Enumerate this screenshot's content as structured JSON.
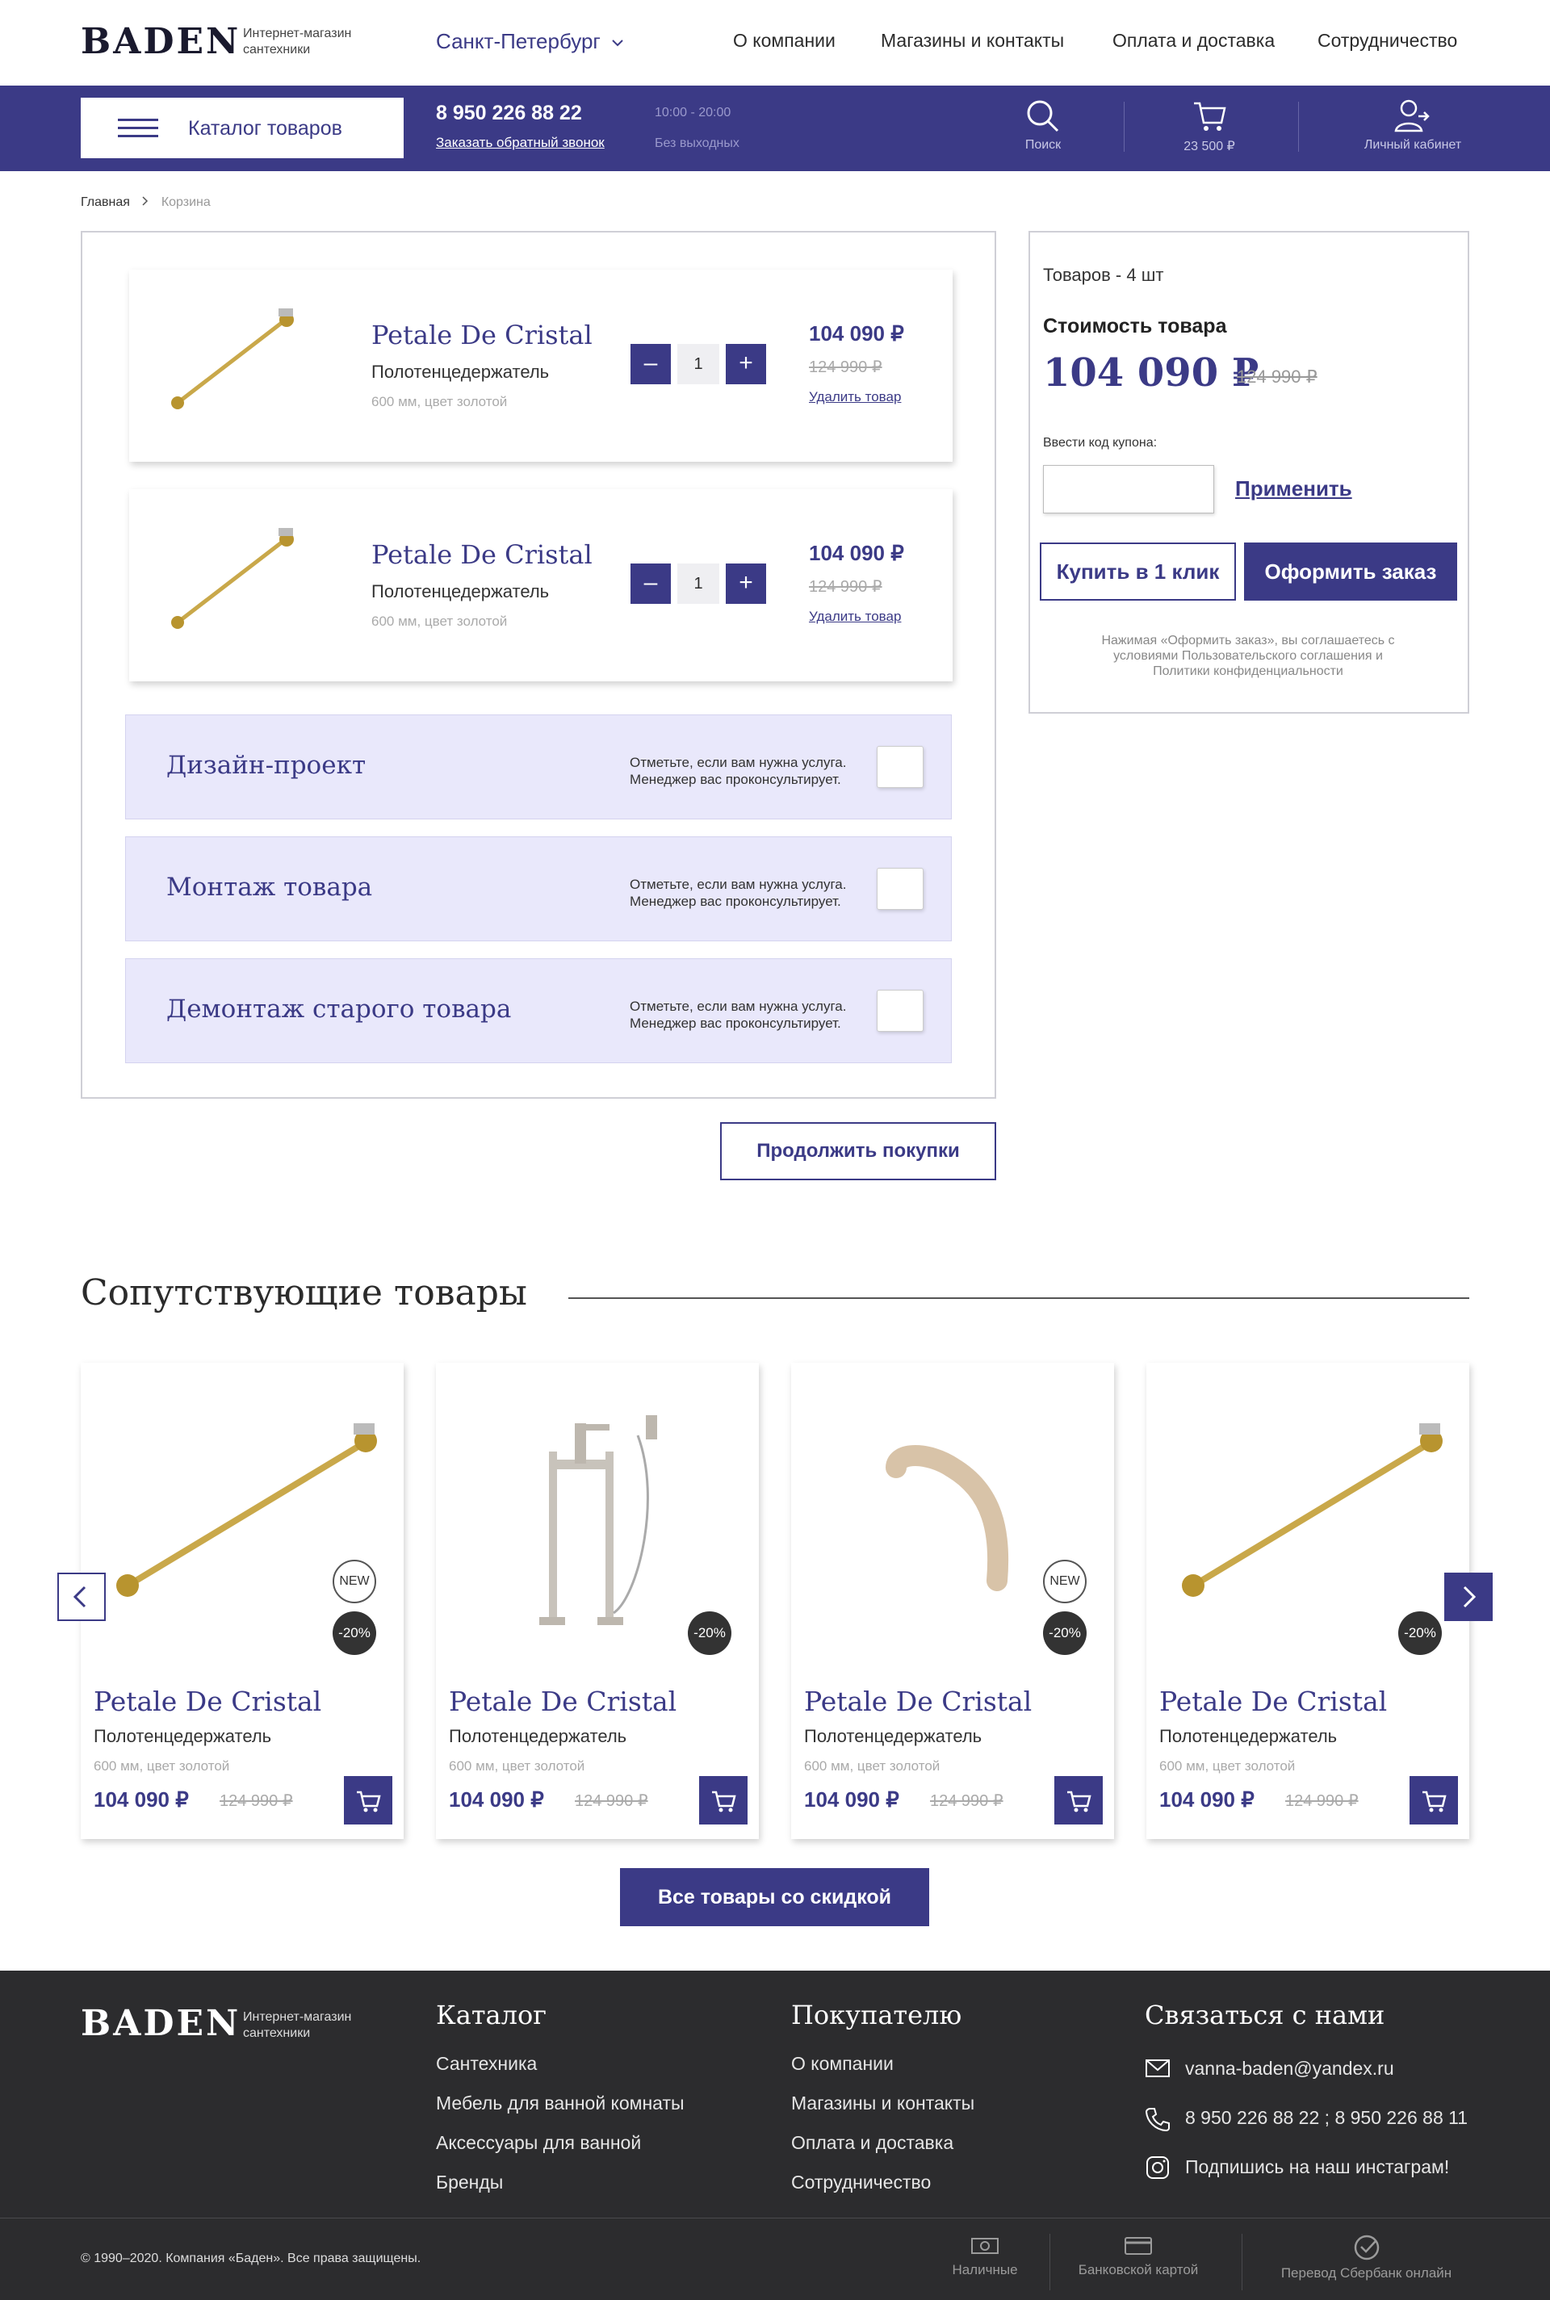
{
  "header": {
    "logo": "BADEN",
    "logo_sub_1": "Интернет-магазин",
    "logo_sub_2": "сантехники",
    "city": "Санкт-Петербург",
    "nav": [
      "О компании",
      "Магазины и контакты",
      "Оплата и доставка",
      "Сотрудничество"
    ],
    "catalog_label": "Каталог товаров",
    "phone": "8 950 226 88 22",
    "callback": "Заказать обратный звонок",
    "hours": "10:00 - 20:00",
    "days": "Без выходных",
    "search_label": "Поиск",
    "cart_total": "23 500 ₽",
    "account_label": "Личный кабинет"
  },
  "breadcrumb": {
    "home": "Главная",
    "current": "Корзина"
  },
  "cart": {
    "items": [
      {
        "title": "Petale De Cristal",
        "subtitle": "Полотенцедержатель",
        "meta": "600 мм, цвет золотой",
        "qty": "1",
        "price": "104 090 ₽",
        "old_price": "124 990 ₽",
        "remove": "Удалить товар"
      },
      {
        "title": "Petale De Cristal",
        "subtitle": "Полотенцедержатель",
        "meta": "600 мм, цвет золотой",
        "qty": "1",
        "price": "104 090 ₽",
        "old_price": "124 990 ₽",
        "remove": "Удалить товар"
      }
    ],
    "services": [
      {
        "title": "Дизайн-проект",
        "note_1": "Отметьте, если вам нужна услуга.",
        "note_2": "Менеджер вас проконсультирует."
      },
      {
        "title": "Монтаж товара",
        "note_1": "Отметьте, если вам нужна услуга.",
        "note_2": "Менеджер вас проконсультирует."
      },
      {
        "title": "Демонтаж старого товара",
        "note_1": "Отметьте, если вам нужна услуга.",
        "note_2": "Менеджер вас проконсультирует."
      }
    ],
    "continue": "Продолжить покупки"
  },
  "summary": {
    "count": "Товаров - 4 шт",
    "cost_label": "Стоимость товара",
    "total": "104 090 ₽",
    "old_total": "124 990 ₽",
    "coupon_label": "Ввести код купона:",
    "coupon_value": "",
    "apply": "Применить",
    "one_click": "Купить в 1 клик",
    "checkout": "Оформить заказ",
    "agreement_1": "Нажимая «Оформить заказ», вы соглашаетесь с",
    "agreement_2": "условиями Пользовательского соглашения и",
    "agreement_3": "Политики конфиденциальности"
  },
  "related": {
    "heading": "Сопутствующие товары",
    "products": [
      {
        "title": "Petale De Cristal",
        "subtitle": "Полотенцедержатель",
        "meta": "600 мм, цвет золотой",
        "price": "104 090 ₽",
        "old_price": "124 990 ₽",
        "badge_new": "NEW",
        "badge_sale": "-20%",
        "image": "towel-bar"
      },
      {
        "title": "Petale De Cristal",
        "subtitle": "Полотенцедержатель",
        "meta": "600 мм, цвет золотой",
        "price": "104 090 ₽",
        "old_price": "124 990 ₽",
        "badge_new": "",
        "badge_sale": "-20%",
        "image": "bath-mixer"
      },
      {
        "title": "Petale De Cristal",
        "subtitle": "Полотенцедержатель",
        "meta": "600 мм, цвет золотой",
        "price": "104 090 ₽",
        "old_price": "124 990 ₽",
        "badge_new": "NEW",
        "badge_sale": "-20%",
        "image": "spout"
      },
      {
        "title": "Petale De Cristal",
        "subtitle": "Полотенцедержатель",
        "meta": "600 мм, цвет золотой",
        "price": "104 090 ₽",
        "old_price": "124 990 ₽",
        "badge_new": "",
        "badge_sale": "-20%",
        "image": "towel-bar"
      }
    ],
    "all_discount": "Все товары со скидкой"
  },
  "footer": {
    "logo": "BADEN",
    "logo_sub_1": "Интернет-магазин",
    "logo_sub_2": "сантехники",
    "catalog_title": "Каталог",
    "catalog_links": [
      "Сантехника",
      "Мебель для ванной комнаты",
      "Аксессуары для ванной",
      "Бренды"
    ],
    "buyer_title": "Покупателю",
    "buyer_links": [
      "О компании",
      "Магазины и контакты",
      "Оплата и доставка",
      "Сотрудничество"
    ],
    "contact_title": "Связаться с нами",
    "email": "vanna-baden@yandex.ru",
    "phones": "8 950 226 88 22 ; 8 950 226 88 11",
    "instagram": "Подпишись на наш инстаграм!",
    "copyright": "© 1990–2020. Компания «Баден». Все права защищены.",
    "payments": [
      "Наличные",
      "Банковской картой",
      "Перевод Сбербанк онлайн"
    ]
  },
  "colors": {
    "accent": "#3b3a86",
    "service_bg": "#e9e8fb",
    "footer_bg": "#2c2c2e"
  }
}
